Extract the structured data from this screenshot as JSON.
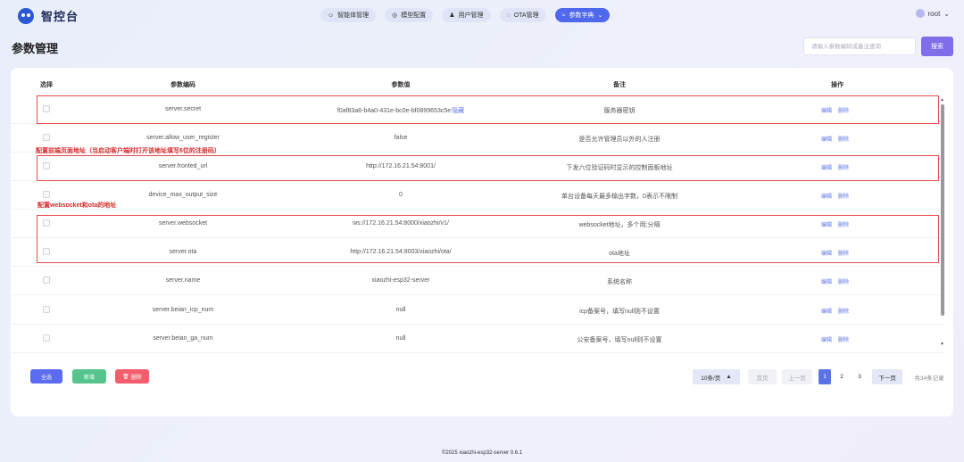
{
  "brand": {
    "name": "智控台"
  },
  "nav": {
    "items": [
      {
        "label": "智能体管理",
        "icon": "agent-icon"
      },
      {
        "label": "模型配置",
        "icon": "model-icon"
      },
      {
        "label": "用户管理",
        "icon": "user-icon"
      },
      {
        "label": "OTA管理",
        "icon": "ota-icon"
      },
      {
        "label": "参数字典",
        "icon": "dict-icon",
        "active": true
      }
    ],
    "dropdown_icon": "chevron-down-icon"
  },
  "user": {
    "name": "root"
  },
  "page": {
    "title": "参数管理"
  },
  "search": {
    "placeholder": "请输入参数编码或备注查询",
    "button_label": "搜索"
  },
  "table": {
    "headers": {
      "select": "选择",
      "code": "参数编码",
      "value": "参数值",
      "remark": "备注",
      "ops": "操作"
    },
    "rows": [
      {
        "code": "server.secret",
        "value": "f0af83a6-b4a0-431e-bc0e-bf0899653c5e",
        "value_link": "隐藏",
        "remark": "服务器密钥"
      },
      {
        "code": "server.allow_user_register",
        "value": "false",
        "remark": "是否允许管理员以外的人注册"
      },
      {
        "code": "server.fronted_url",
        "value": "http://172.16.21.54:8001/",
        "remark": "下发六位验证码时显示的控制面板地址"
      },
      {
        "code": "device_max_output_size",
        "value": "0",
        "remark": "单台设备每天最多输出字数，0表示不限制"
      },
      {
        "code": "server.websocket",
        "value": "ws://172.16.21.54:8000/xiaozhi/v1/",
        "remark": "websocket地址，多个用;分隔"
      },
      {
        "code": "server.ota",
        "value": "http://172.16.21.54:8003/xiaozhi/ota/",
        "remark": "ota地址"
      },
      {
        "code": "server.name",
        "value": "xiaozhi-esp32-server",
        "remark": "系统名称"
      },
      {
        "code": "server.beian_icp_num",
        "value": "null",
        "remark": "icp备案号，填写null则不设置"
      },
      {
        "code": "server.beian_ga_num",
        "value": "null",
        "remark": "公安备案号，填写null则不设置"
      }
    ],
    "edit_label": "编辑",
    "delete_label": "删除"
  },
  "annotations": {
    "fronted_note": "配置前端页面地址（当启动客户端时打开该地址填写6位的注册码）",
    "websocket_note": "配置websocket和ota的地址"
  },
  "footer_buttons": {
    "select_all": "全选",
    "add": "新增",
    "delete": "删除"
  },
  "pagination": {
    "page_size": "10条/页",
    "first": "首页",
    "prev": "上一页",
    "pages": [
      "1",
      "2",
      "3"
    ],
    "current": "1",
    "next": "下一页",
    "total": "共34条记录"
  },
  "copyright": "©2025 xiaozhi-esp32-server 0.6.1",
  "colors": {
    "accent": "#5a74e6",
    "annotation": "#d42a2a",
    "search": "#7f6de9",
    "add": "#56c48c",
    "delete": "#f25e6c"
  }
}
